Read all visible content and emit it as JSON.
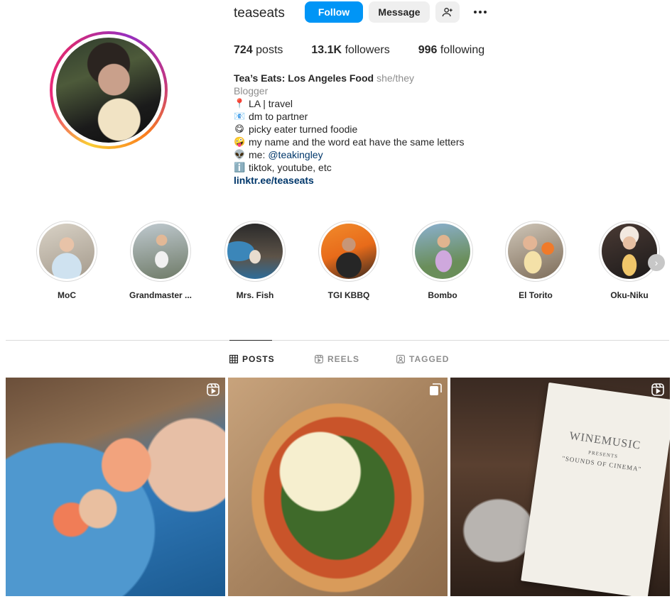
{
  "profile": {
    "username": "teaseats",
    "follow_label": "Follow",
    "message_label": "Message",
    "stats": {
      "posts_count": "724",
      "posts_label": "posts",
      "followers_count": "13.1K",
      "followers_label": "followers",
      "following_count": "996",
      "following_label": "following"
    },
    "bio": {
      "name": "Tea’s Eats: Los Angeles Food",
      "pronouns": "she/they",
      "category": "Blogger",
      "lines": [
        {
          "emoji": "📍",
          "text": "LA | travel"
        },
        {
          "emoji": "📧",
          "text": "dm to partner"
        },
        {
          "emoji": "😋",
          "text": "picky eater turned foodie"
        },
        {
          "emoji": "🤪",
          "text": "my name and the word eat have the same letters"
        },
        {
          "emoji": "👽",
          "text": "me:",
          "mention": "@teakingley"
        },
        {
          "emoji": "ℹ️",
          "text": "tiktok, youtube, etc"
        }
      ],
      "link": "linktr.ee/teaseats"
    }
  },
  "highlights": [
    {
      "label": "MoC"
    },
    {
      "label": "Grandmaster ..."
    },
    {
      "label": "Mrs. Fish"
    },
    {
      "label": "TGI KBBQ"
    },
    {
      "label": "Bombo"
    },
    {
      "label": "El Torito"
    },
    {
      "label": "Oku-Niku"
    }
  ],
  "tabs": [
    {
      "label": "POSTS",
      "active": true
    },
    {
      "label": "REELS",
      "active": false
    },
    {
      "label": "TAGGED",
      "active": false
    }
  ],
  "posts": [
    {
      "type": "reel",
      "icon": "reel-icon"
    },
    {
      "type": "carousel",
      "icon": "carousel-icon"
    },
    {
      "type": "reel",
      "icon": "reel-icon",
      "menu_text": {
        "logo": "WINEMUSIC",
        "presents": "PRESENTS",
        "title": "\"SOUNDS OF CINEMA\""
      }
    }
  ],
  "colors": {
    "primary_button": "#0095f6",
    "link": "#00376b",
    "muted": "#8e8e8e"
  }
}
